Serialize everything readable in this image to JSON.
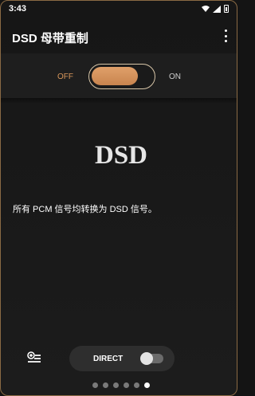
{
  "status_bar": {
    "time": "3:43",
    "icons": [
      "wifi-icon",
      "signal-icon",
      "battery-icon"
    ]
  },
  "app_bar": {
    "title": "DSD 母带重制",
    "menu_icon": "more-vert-icon"
  },
  "remaster_toggle": {
    "off_label": "OFF",
    "on_label": "ON",
    "state": "off",
    "accent_color": "#d8965a"
  },
  "logo": {
    "text": "DSD"
  },
  "description": "所有 PCM 信号均转换为 DSD 信号。",
  "bottom_controls": {
    "queue_icon": "add-queue-icon",
    "direct_label": "DIRECT",
    "direct_state": "off"
  },
  "pagination": {
    "total": 6,
    "active_index": 5
  }
}
